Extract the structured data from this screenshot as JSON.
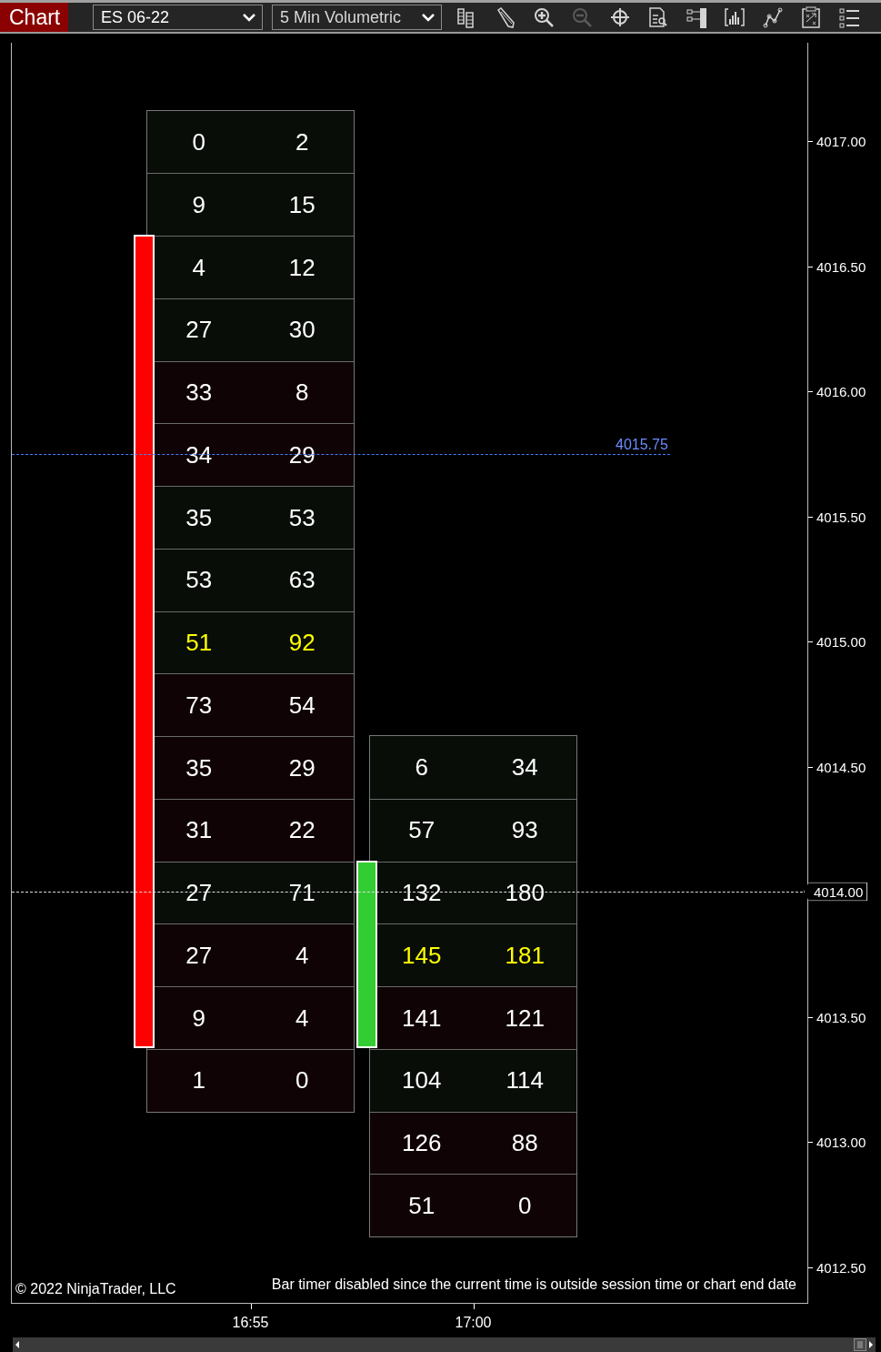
{
  "toolbar": {
    "title": "Chart",
    "instrument": "ES 06-22",
    "bar_type": "5 Min Volumetric",
    "tools": [
      {
        "kind": "data-box",
        "disabled": false
      },
      {
        "kind": "pencil",
        "disabled": false
      },
      {
        "kind": "zoom-in",
        "disabled": false
      },
      {
        "kind": "zoom-out",
        "disabled": true
      },
      {
        "kind": "crosshair",
        "disabled": false
      },
      {
        "kind": "properties",
        "disabled": false
      },
      {
        "kind": "order-panel",
        "disabled": false
      },
      {
        "kind": "bars",
        "disabled": false
      },
      {
        "kind": "line",
        "disabled": false
      },
      {
        "kind": "template",
        "disabled": false
      },
      {
        "kind": "list",
        "disabled": false
      }
    ]
  },
  "chart": {
    "price_axis": [
      "4017.00",
      "4016.50",
      "4016.00",
      "4015.50",
      "4015.00",
      "4014.50",
      "4013.50",
      "4013.00",
      "4012.50"
    ],
    "bars": [
      {
        "time": "16:55",
        "up": false,
        "rows": [
          {
            "bid": "0",
            "ask": "2",
            "sell_heavy": false,
            "poc": false,
            "body": false
          },
          {
            "bid": "9",
            "ask": "15",
            "sell_heavy": false,
            "poc": false,
            "body": false
          },
          {
            "bid": "4",
            "ask": "12",
            "sell_heavy": false,
            "poc": false,
            "body": true
          },
          {
            "bid": "27",
            "ask": "30",
            "sell_heavy": false,
            "poc": false,
            "body": true
          },
          {
            "bid": "33",
            "ask": "8",
            "sell_heavy": true,
            "poc": false,
            "body": true
          },
          {
            "bid": "34",
            "ask": "29",
            "sell_heavy": true,
            "poc": false,
            "body": true
          },
          {
            "bid": "35",
            "ask": "53",
            "sell_heavy": false,
            "poc": false,
            "body": true
          },
          {
            "bid": "53",
            "ask": "63",
            "sell_heavy": false,
            "poc": false,
            "body": true
          },
          {
            "bid": "51",
            "ask": "92",
            "sell_heavy": false,
            "poc": true,
            "body": true
          },
          {
            "bid": "73",
            "ask": "54",
            "sell_heavy": true,
            "poc": false,
            "body": true
          },
          {
            "bid": "35",
            "ask": "29",
            "sell_heavy": true,
            "poc": false,
            "body": true
          },
          {
            "bid": "31",
            "ask": "22",
            "sell_heavy": true,
            "poc": false,
            "body": true
          },
          {
            "bid": "27",
            "ask": "71",
            "sell_heavy": false,
            "poc": false,
            "body": true
          },
          {
            "bid": "27",
            "ask": "4",
            "sell_heavy": true,
            "poc": false,
            "body": true
          },
          {
            "bid": "9",
            "ask": "4",
            "sell_heavy": true,
            "poc": false,
            "body": true
          },
          {
            "bid": "1",
            "ask": "0",
            "sell_heavy": true,
            "poc": false,
            "body": false
          }
        ]
      },
      {
        "time": "17:00",
        "up": true,
        "rows": [
          {
            "bid": "6",
            "ask": "34",
            "sell_heavy": false,
            "poc": false,
            "body": false
          },
          {
            "bid": "57",
            "ask": "93",
            "sell_heavy": false,
            "poc": false,
            "body": false
          },
          {
            "bid": "132",
            "ask": "180",
            "sell_heavy": false,
            "poc": false,
            "body": true
          },
          {
            "bid": "145",
            "ask": "181",
            "sell_heavy": false,
            "poc": true,
            "body": true
          },
          {
            "bid": "141",
            "ask": "121",
            "sell_heavy": true,
            "poc": false,
            "body": true
          },
          {
            "bid": "104",
            "ask": "114",
            "sell_heavy": false,
            "poc": false,
            "body": false
          },
          {
            "bid": "126",
            "ask": "88",
            "sell_heavy": true,
            "poc": false,
            "body": false
          },
          {
            "bid": "51",
            "ask": "0",
            "sell_heavy": true,
            "poc": false,
            "body": false
          }
        ]
      }
    ],
    "price_lines": [
      {
        "kind": "marker",
        "label": "4015.75"
      },
      {
        "kind": "last",
        "label": "4014.00"
      }
    ],
    "copyright": "© 2022 NinjaTrader, LLC",
    "notice": "Bar timer disabled since the current time is outside session time or chart end date"
  }
}
